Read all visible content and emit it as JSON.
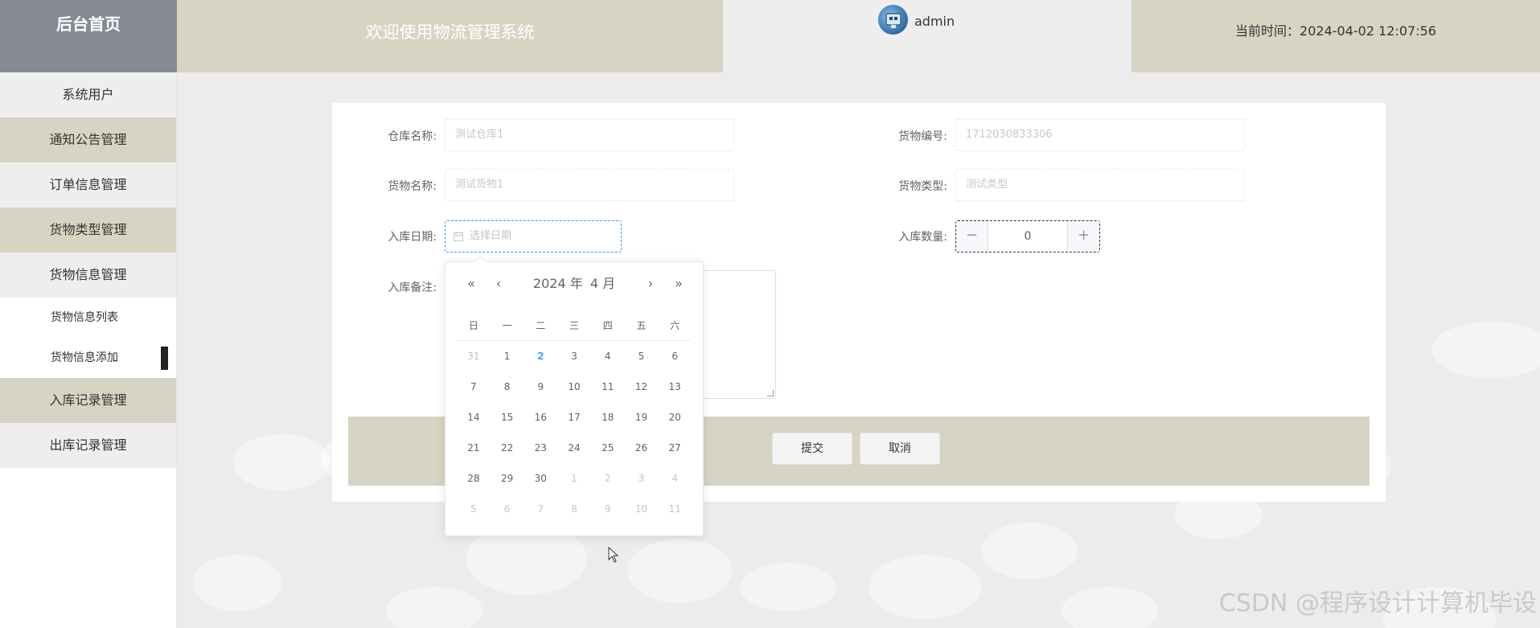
{
  "header": {
    "brand": "后台首页",
    "welcome": "欢迎使用物流管理系统",
    "username": "admin",
    "time_label": "当前时间：",
    "time_value": "2024-04-02 12:07:56"
  },
  "sidebar": {
    "items": [
      {
        "label": "系统用户"
      },
      {
        "label": "通知公告管理"
      },
      {
        "label": "订单信息管理"
      },
      {
        "label": "货物类型管理"
      },
      {
        "label": "货物信息管理"
      },
      {
        "label": "入库记录管理"
      },
      {
        "label": "出库记录管理"
      }
    ],
    "sub_items": [
      {
        "label": "货物信息列表"
      },
      {
        "label": "货物信息添加"
      }
    ]
  },
  "form": {
    "warehouse_label": "仓库名称:",
    "warehouse_value": "测试仓库1",
    "goods_no_label": "货物编号:",
    "goods_no_value": "1712030833306",
    "goods_name_label": "货物名称:",
    "goods_name_value": "测试货物1",
    "goods_type_label": "货物类型:",
    "goods_type_value": "测试类型",
    "date_label": "入库日期:",
    "date_placeholder": "选择日期",
    "qty_label": "入库数量:",
    "qty_value": "0",
    "qty_minus": "−",
    "qty_plus": "+",
    "remark_label": "入库备注:",
    "submit": "提交",
    "cancel": "取消"
  },
  "datepicker": {
    "year": "2024 年",
    "month": "4 月",
    "prev_year": "«",
    "prev_month": "‹",
    "next_month": "›",
    "next_year": "»",
    "weekdays": [
      "日",
      "一",
      "二",
      "三",
      "四",
      "五",
      "六"
    ],
    "weeks": [
      [
        "31",
        "1",
        "2",
        "3",
        "4",
        "5",
        "6"
      ],
      [
        "7",
        "8",
        "9",
        "10",
        "11",
        "12",
        "13"
      ],
      [
        "14",
        "15",
        "16",
        "17",
        "18",
        "19",
        "20"
      ],
      [
        "21",
        "22",
        "23",
        "24",
        "25",
        "26",
        "27"
      ],
      [
        "28",
        "29",
        "30",
        "1",
        "2",
        "3",
        "4"
      ],
      [
        "5",
        "6",
        "7",
        "8",
        "9",
        "10",
        "11"
      ]
    ],
    "today": "2"
  },
  "watermark": "CSDN @程序设计计算机毕设",
  "colors": {
    "brand_bg": "#858a93",
    "tan": "#d8d4c4",
    "light": "#eeeeee",
    "accent": "#409eff"
  }
}
